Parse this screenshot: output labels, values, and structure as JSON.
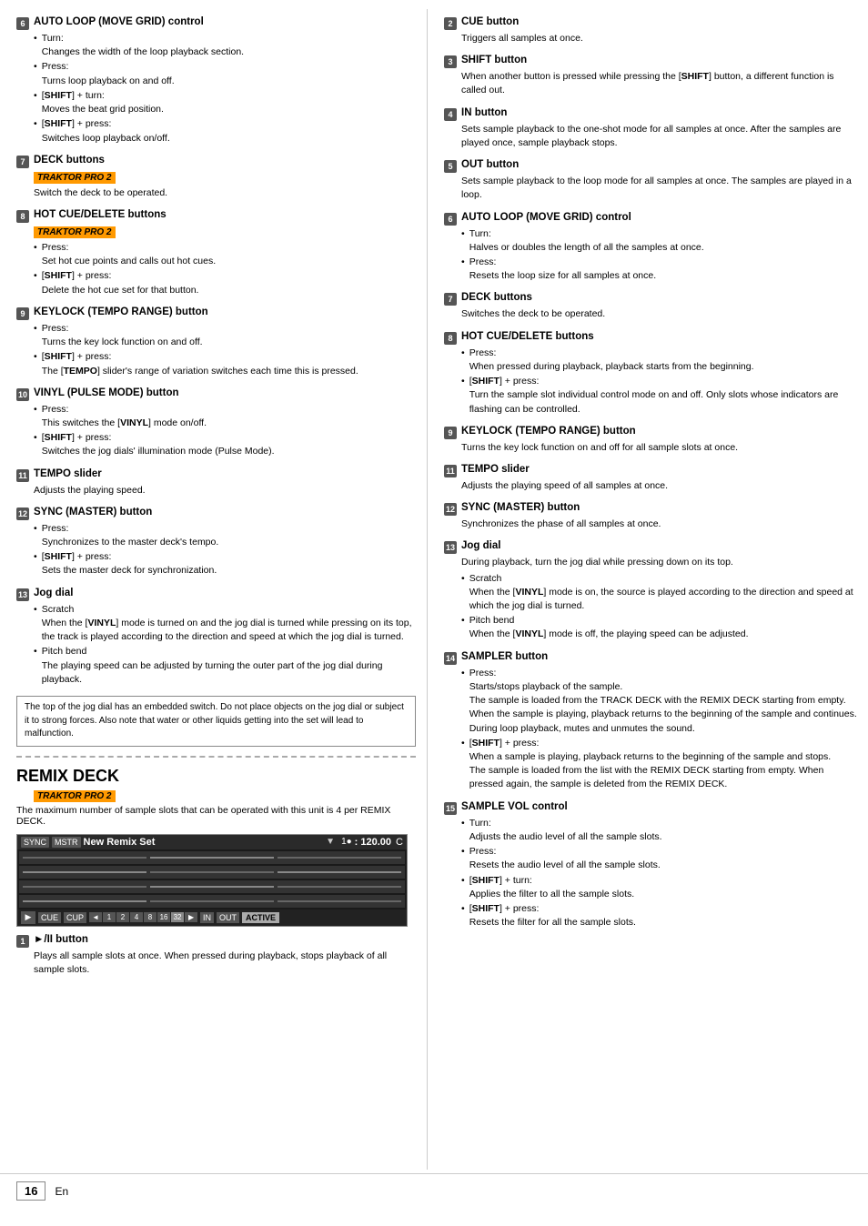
{
  "left_col": {
    "sections": [
      {
        "id": "6",
        "title": "AUTO LOOP (MOVE GRID) control",
        "bullets": [
          {
            "label": "Turn:",
            "desc": "Changes the width of the loop playback section."
          },
          {
            "label": "Press:",
            "desc": "Turns loop playback on and off."
          },
          {
            "label": "[SHIFT] + turn:",
            "desc": "Moves the beat grid position.",
            "shift": true
          },
          {
            "label": "[SHIFT] + press:",
            "desc": "Switches loop playback on/off.",
            "shift": true
          }
        ]
      },
      {
        "id": "7",
        "title": "DECK buttons",
        "badge": "TRAKTOR PRO 2",
        "plain": "Switch the deck to be operated."
      },
      {
        "id": "8",
        "title": "HOT CUE/DELETE buttons",
        "badge": "TRAKTOR PRO 2",
        "bullets": [
          {
            "label": "Press:",
            "desc": "Set hot cue points and calls out hot cues."
          },
          {
            "label": "[SHIFT] + press:",
            "desc": "Delete the hot cue set for that button.",
            "shift": true
          }
        ]
      },
      {
        "id": "9",
        "title": "KEYLOCK (TEMPO RANGE) button",
        "bullets": [
          {
            "label": "Press:",
            "desc": "Turns the key lock function on and off."
          },
          {
            "label": "[SHIFT] + press:",
            "desc": "The [TEMPO] slider's range of variation switches each time this is pressed.",
            "shift": true
          }
        ]
      },
      {
        "id": "10",
        "title": "VINYL (PULSE MODE) button",
        "bullets": [
          {
            "label": "Press:",
            "desc": "This switches the [VINYL] mode on/off."
          },
          {
            "label": "[SHIFT] + press:",
            "desc": "Switches the jog dials' illumination mode (Pulse Mode).",
            "shift": true
          }
        ]
      },
      {
        "id": "11",
        "title": "TEMPO slider",
        "plain": "Adjusts the playing speed."
      },
      {
        "id": "12",
        "title": "SYNC (MASTER) button",
        "bullets": [
          {
            "label": "Press:",
            "desc": "Synchronizes to the master deck's tempo."
          },
          {
            "label": "[SHIFT] + press:",
            "desc": "Sets the master deck for synchronization.",
            "shift": true
          }
        ]
      },
      {
        "id": "13",
        "title": "Jog dial",
        "sub_bullets": [
          {
            "label": "Scratch",
            "desc": "When the [VINYL] mode is turned on and the jog dial is turned while pressing on its top, the track is played according to the direction and speed at which the jog dial is turned."
          },
          {
            "label": "Pitch bend",
            "desc": "The playing speed can be adjusted by turning the outer part of the jog dial during playback."
          }
        ]
      }
    ],
    "note": "The top of the jog dial has an embedded switch. Do not place objects on the jog dial or subject it to strong forces. Also note that water or other liquids getting into the set will lead to malfunction.",
    "remix_deck": {
      "title": "REMIX DECK",
      "badge": "TRAKTOR PRO 2",
      "intro": "The maximum number of sample slots that can be operated with this unit is 4 per REMIX DECK.",
      "display": {
        "top_bar": {
          "sync": "SYNC",
          "mstr": "MSTR",
          "title": "New Remix Set",
          "arrow": "▼",
          "num": "1●",
          "bpm": ": 120.00",
          "key": "C"
        },
        "slots": 4,
        "bottom_bar": {
          "play": "▶",
          "cue": "CUE",
          "cup": "CUP",
          "nums": [
            "◄",
            "2",
            "4",
            "8",
            "16",
            "32",
            "▶"
          ],
          "active_num": "32",
          "in": "IN",
          "out": "OUT",
          "active": "ACTIVE"
        }
      },
      "play_button_section": {
        "id": "1",
        "title": "►/II button",
        "desc": "Plays all sample slots at once. When pressed during playback, stops playback of all sample slots."
      }
    }
  },
  "right_col": {
    "sections": [
      {
        "id": "2",
        "title": "CUE button",
        "plain": "Triggers all samples at once."
      },
      {
        "id": "3",
        "title": "SHIFT button",
        "plain": "When another button is pressed while pressing the [SHIFT] button, a different function is called out."
      },
      {
        "id": "4",
        "title": "IN button",
        "plain": "Sets sample playback to the one-shot mode for all samples at once. After the samples are played once, sample playback stops."
      },
      {
        "id": "5",
        "title": "OUT button",
        "plain": "Sets sample playback to the loop mode for all samples at once. The samples are played in a loop."
      },
      {
        "id": "6",
        "title": "AUTO LOOP (MOVE GRID) control",
        "bullets": [
          {
            "label": "Turn:",
            "desc": "Halves or doubles the length of all the samples at once."
          },
          {
            "label": "Press:",
            "desc": "Resets the loop size for all samples at once."
          }
        ]
      },
      {
        "id": "7",
        "title": "DECK buttons",
        "plain": "Switches the deck to be operated."
      },
      {
        "id": "8",
        "title": "HOT CUE/DELETE buttons",
        "bullets": [
          {
            "label": "Press:",
            "desc": "When pressed during playback, playback starts from the beginning."
          },
          {
            "label": "[SHIFT] + press:",
            "desc": "Turn the sample slot individual control mode on and off. Only slots whose indicators are flashing can be controlled.",
            "shift": true
          }
        ]
      },
      {
        "id": "9",
        "title": "KEYLOCK (TEMPO RANGE) button",
        "plain": "Turns the key lock function on and off for all sample slots at once."
      },
      {
        "id": "11",
        "title": "TEMPO slider",
        "plain": "Adjusts the playing speed of all samples at once."
      },
      {
        "id": "12",
        "title": "SYNC (MASTER) button",
        "plain": "Synchronizes the phase of all samples at once."
      },
      {
        "id": "13",
        "title": "Jog dial",
        "plain": "During playback, turn the jog dial while pressing down on its top.",
        "sub_bullets": [
          {
            "label": "Scratch",
            "desc": "When the [VINYL] mode is on, the source is played according to the direction and speed at which the jog dial is turned."
          },
          {
            "label": "Pitch bend",
            "desc": "When the [VINYL] mode is off, the playing speed can be adjusted."
          }
        ]
      },
      {
        "id": "14",
        "title": "SAMPLER button",
        "bullets": [
          {
            "label": "Press:",
            "descs": [
              "Starts/stops playback of the sample.",
              "The sample is loaded from the TRACK DECK with the REMIX DECK starting from empty.",
              "When the sample is playing, playback returns to the beginning of the sample and continues.",
              "During loop playback, mutes and unmutes the sound."
            ]
          },
          {
            "label": "[SHIFT] + press:",
            "shift": true,
            "descs": [
              "When a sample is playing, playback returns to the beginning of the sample and stops.",
              "The sample is loaded from the list with the REMIX DECK starting from empty. When pressed again, the sample is deleted from the REMIX DECK."
            ]
          }
        ]
      },
      {
        "id": "15",
        "title": "SAMPLE VOL control",
        "bullets": [
          {
            "label": "Turn:",
            "desc": "Adjusts the audio level of all the sample slots."
          },
          {
            "label": "Press:",
            "desc": "Resets the audio level of all the sample slots."
          },
          {
            "label": "[SHIFT] + turn:",
            "desc": "Applies the filter to all the sample slots.",
            "shift": true
          },
          {
            "label": "[SHIFT] + press:",
            "desc": "Resets the filter for all the sample slots.",
            "shift": true
          }
        ]
      }
    ]
  },
  "footer": {
    "page_num": "16",
    "lang": "En"
  }
}
